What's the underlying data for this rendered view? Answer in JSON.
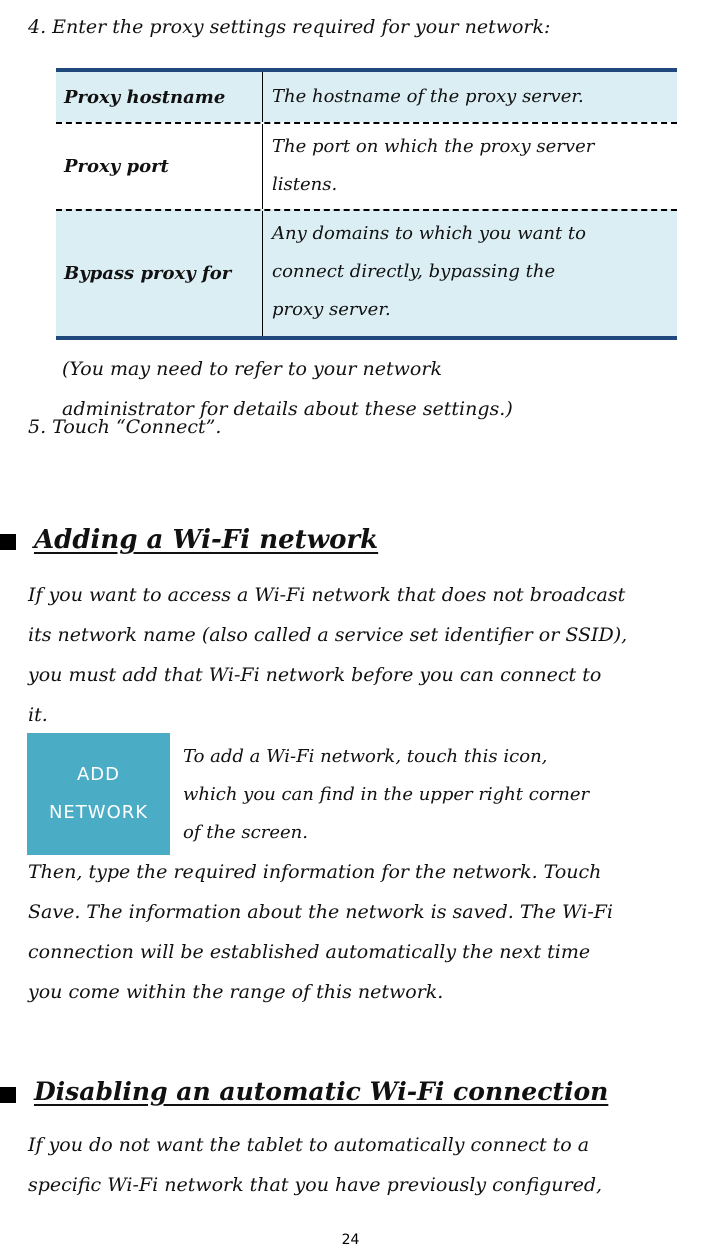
{
  "step4": "4. Enter the proxy settings required for your network:",
  "proxy_table": {
    "rows": [
      {
        "key": "Proxy hostname",
        "value_lines": [
          "The hostname of the proxy server."
        ]
      },
      {
        "key": "Proxy port",
        "value_lines": [
          "The port on which the proxy server",
          "listens."
        ]
      },
      {
        "key": "Bypass proxy for",
        "value_lines": [
          "Any domains to which you want to",
          "connect directly, bypassing the",
          "proxy server."
        ]
      }
    ]
  },
  "note_lines": [
    "(You may need to refer to your network",
    "administrator for details about these settings.)"
  ],
  "step5": "5. Touch “Connect”.",
  "section1": {
    "heading": "Adding a Wi-Fi network",
    "para_lines": [
      "If you want to access a Wi-Fi network that does not broadcast",
      "its network name (also called a service set identifier or SSID),",
      "you must add that Wi-Fi network before you can connect to",
      "it."
    ],
    "icon_label_lines": [
      "ADD",
      "NETWORK"
    ],
    "icon_caption_lines": [
      "To add a Wi-Fi network, touch this icon,",
      "which you can find in the upper right corner",
      "of the screen."
    ],
    "para2_lines": [
      "Then, type the required information for the network. Touch",
      "Save. The information about the network is saved. The Wi-Fi",
      "connection will be established automatically the next time",
      "you come within the range of this network."
    ]
  },
  "section2": {
    "heading": "Disabling an automatic Wi-Fi connection",
    "para_lines": [
      "If you do not want the tablet to automatically connect to a",
      "specific Wi-Fi network that you have previously configured,"
    ]
  },
  "page_number": "24",
  "colors": {
    "table_border": "#1f497d",
    "table_shade": "#dbeef4",
    "icon_bg": "#4bacc6",
    "icon_text": "#ffffff"
  }
}
